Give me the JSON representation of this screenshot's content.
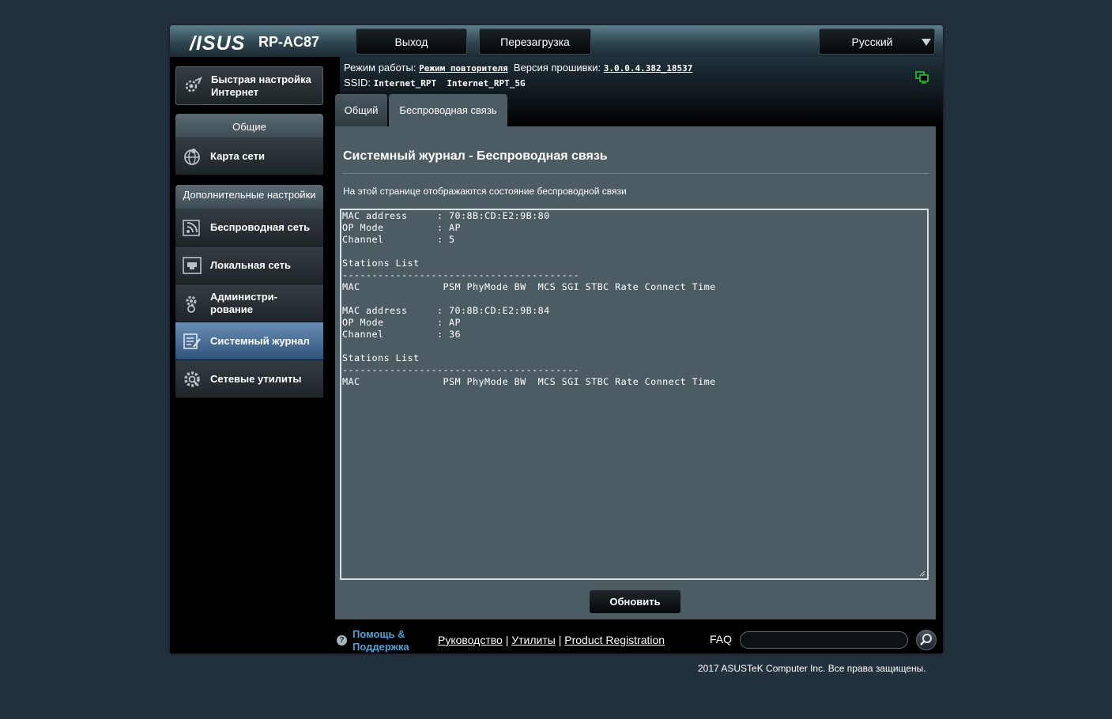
{
  "header": {
    "logo": "/ISUS",
    "model": "RP-AC87",
    "logout": "Выход",
    "reboot": "Перезагрузка",
    "language": "Русский",
    "mode_label": "Режим работы:",
    "mode_value": "Режим повторителя",
    "firmware_label": "Версия прошивки:",
    "firmware_value": "3.0.0.4.382_18537",
    "ssid_label": "SSID:",
    "ssid_values": "Internet_RPT  Internet_RPT_5G"
  },
  "sidebar": {
    "quick_setup": "Быстрая настройка Интернет",
    "section_general": "Общие",
    "network_map": "Карта сети",
    "section_advanced": "Дополнительные настройки",
    "wireless": "Беспроводная сеть",
    "lan": "Локальная сеть",
    "admin": "Администри-рование",
    "syslog": "Системный журнал",
    "tools": "Сетевые утилиты"
  },
  "tabs": {
    "general": "Общий",
    "wireless": "Беспроводная связь"
  },
  "content": {
    "title": "Системный журнал - Беспроводная связь",
    "description": "На этой странице отображаются состояние беспроводной связи",
    "log": "MAC address     : 70:8B:CD:E2:9B:80\nOP Mode         : AP\nChannel         : 5\n\nStations List\n----------------------------------------\nMAC              PSM PhyMode BW  MCS SGI STBC Rate Connect Time\n\nMAC address     : 70:8B:CD:E2:9B:84\nOP Mode         : AP\nChannel         : 36\n\nStations List\n----------------------------------------\nMAC              PSM PhyMode BW  MCS SGI STBC Rate Connect Time",
    "refresh": "Обновить"
  },
  "footer": {
    "help": "Помощь & Поддержка",
    "manual": "Руководство",
    "utilities": "Утилиты",
    "registration": "Product Registration",
    "faq": "FAQ",
    "search_placeholder": "",
    "copyright": "2017 ASUSTeK Computer Inc. Все права защищены."
  },
  "icons": {
    "quick_setup": "quick-setup-icon",
    "network_map": "globe-icon",
    "wireless": "wifi-icon",
    "lan": "lan-port-icon",
    "admin": "gear-person-icon",
    "syslog": "log-icon",
    "tools": "tools-icon",
    "search": "search-icon",
    "help": "help-icon"
  },
  "colors": {
    "active_menu": "#4f739b",
    "link": "#4fa3d6",
    "content_bg": "#4d5b63"
  }
}
